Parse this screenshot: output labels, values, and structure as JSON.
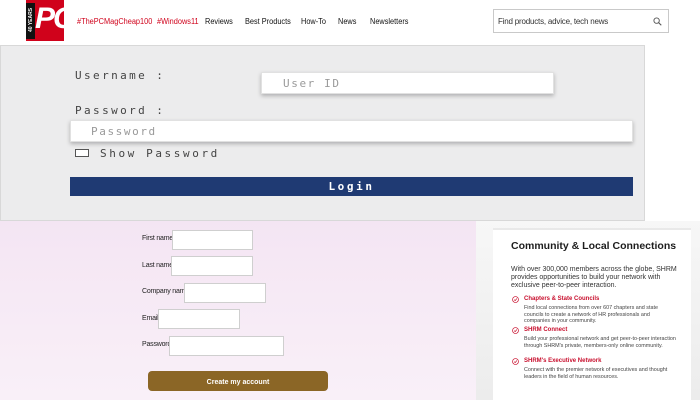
{
  "header": {
    "logo": {
      "text": "PC",
      "side_text": "40 YEARS",
      "color": "#d0021b"
    },
    "nav": [
      {
        "label": "#ThePCMagCheap100",
        "style": "hash"
      },
      {
        "label": "#Windows11",
        "style": "hash"
      },
      {
        "label": "Reviews",
        "style": "plain"
      },
      {
        "label": "Best Products",
        "style": "plain"
      },
      {
        "label": "How-To",
        "style": "plain"
      },
      {
        "label": "News",
        "style": "plain"
      },
      {
        "label": "Newsletters",
        "style": "plain"
      }
    ],
    "search": {
      "placeholder": "Find products, advice, tech news",
      "icon": "search-icon"
    }
  },
  "login_form": {
    "username_label": "Username :",
    "username_placeholder": "User ID",
    "password_label": "Password :",
    "password_placeholder": "Password",
    "show_password_label": "Show Password",
    "show_password_checked": false,
    "login_button": "Login",
    "button_color": "#1f3a73"
  },
  "signup_form": {
    "fields": [
      {
        "label": "First name",
        "value": ""
      },
      {
        "label": "Last name",
        "value": ""
      },
      {
        "label": "Company name",
        "value": ""
      },
      {
        "label": "Email",
        "value": ""
      },
      {
        "label": "Password",
        "value": ""
      }
    ],
    "submit_button": "Create my account",
    "button_color": "#8b6626"
  },
  "shrm_card": {
    "title": "Community & Local Connections",
    "description": "With over 300,000 members across the globe, SHRM provides opportunities to build your network with exclusive peer-to-peer interaction.",
    "features": [
      {
        "icon": "check-circle-icon",
        "title": "Chapters & State Councils",
        "text": "Find local connections from over 607 chapters and state councils to create a network of HR professionals and companies in your community."
      },
      {
        "icon": "check-circle-icon",
        "title": "SHRM Connect",
        "text": "Build your professional network and get peer-to-peer interaction through SHRM's private, members-only online community."
      },
      {
        "icon": "check-circle-icon",
        "title": "SHRM's Executive Network",
        "text": "Connect with the premier network of executives and thought leaders in the field of human resources."
      }
    ],
    "accent_color": "#c8102e"
  }
}
